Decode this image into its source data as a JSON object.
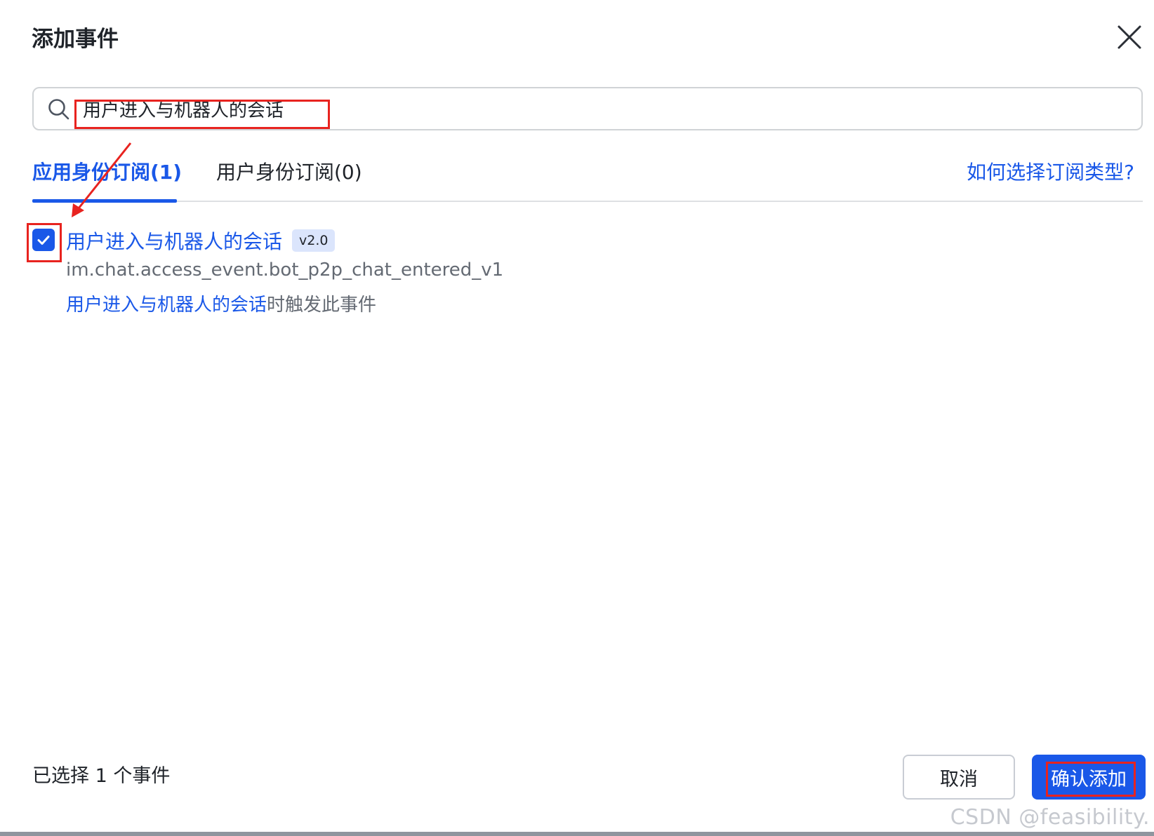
{
  "dialog": {
    "title": "添加事件"
  },
  "search": {
    "value": "用户进入与机器人的会话",
    "placeholder": ""
  },
  "tabs": [
    {
      "label": "应用身份订阅(1)",
      "active": true
    },
    {
      "label": "用户身份订阅(0)",
      "active": false
    }
  ],
  "help_link": "如何选择订阅类型?",
  "events": [
    {
      "checked": true,
      "name": "用户进入与机器人的会话",
      "version": "v2.0",
      "key": "im.chat.access_event.bot_p2p_chat_entered_v1",
      "description_highlight": "用户进入与机器人的会话",
      "description_rest": "时触发此事件"
    }
  ],
  "footer": {
    "selected_count": "已选择 1 个事件",
    "cancel_label": "取消",
    "confirm_label": "确认添加"
  },
  "watermark": "CSDN @feasibility.",
  "colors": {
    "primary": "#1a58e8",
    "annotation": "#e8231f",
    "badge_bg": "#dbe5fc"
  }
}
